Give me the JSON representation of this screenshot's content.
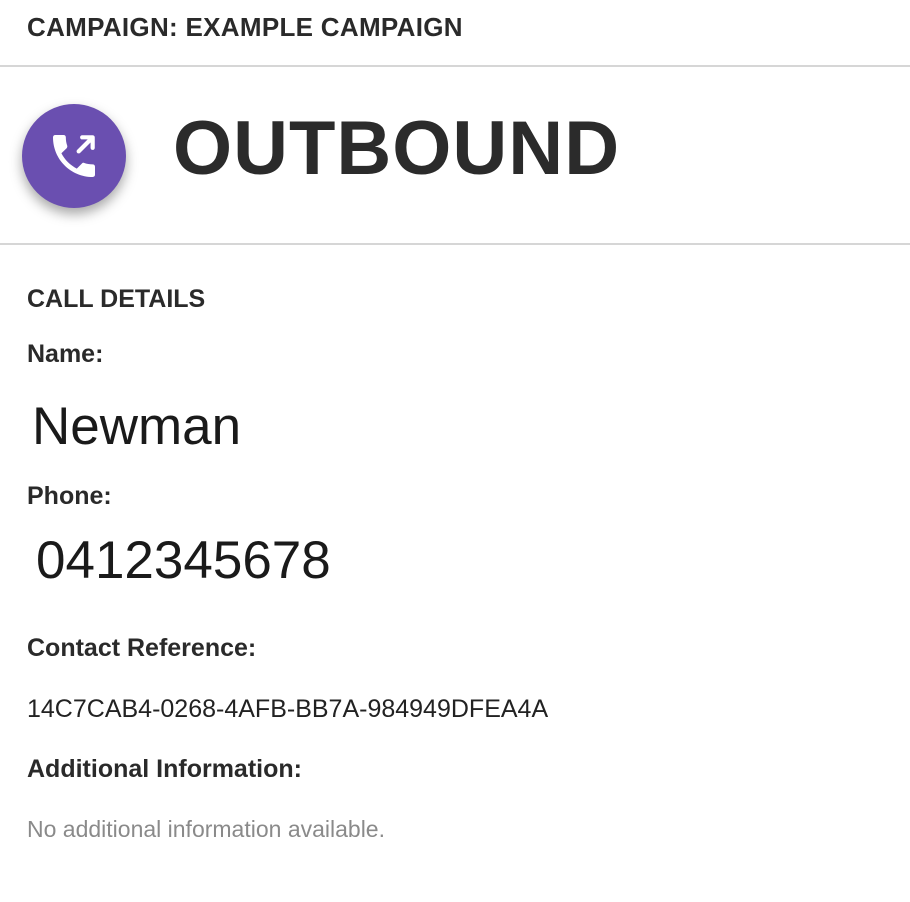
{
  "campaign": {
    "title": "CAMPAIGN: EXAMPLE CAMPAIGN"
  },
  "banner": {
    "direction": "OUTBOUND",
    "icon": "outbound-call-icon",
    "icon_bg_color": "#6a4fb0"
  },
  "call_details": {
    "section_title": "CALL DETAILS",
    "name_label": "Name:",
    "name_value": "Newman",
    "phone_label": "Phone:",
    "phone_value": "0412345678",
    "contact_ref_label": "Contact Reference:",
    "contact_ref_value": "14C7CAB4-0268-4AFB-BB7A-984949DFEA4A",
    "additional_info_label": "Additional Information:",
    "additional_info_value": "No additional information available."
  }
}
